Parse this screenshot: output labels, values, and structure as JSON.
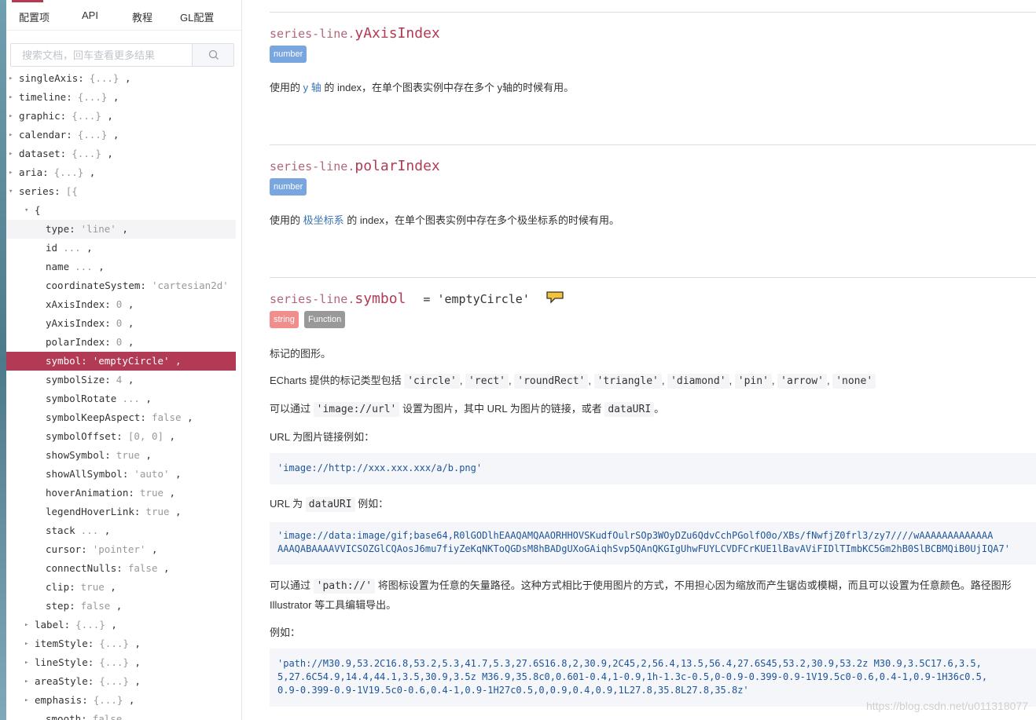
{
  "tabs": [
    "配置项",
    "API",
    "教程",
    "GL配置"
  ],
  "search": {
    "placeholder": "搜索文档，回车查看更多结果",
    "icon": "search-icon"
  },
  "tree": [
    {
      "arrow": "▸",
      "indent": 0,
      "key": "singleAxis:",
      "val": "{...}",
      "tail": " ,"
    },
    {
      "arrow": "▸",
      "indent": 0,
      "key": "timeline:",
      "val": "{...}",
      "tail": " ,"
    },
    {
      "arrow": "▸",
      "indent": 0,
      "key": "graphic:",
      "val": "{...}",
      "tail": " ,"
    },
    {
      "arrow": "▸",
      "indent": 0,
      "key": "calendar:",
      "val": "{...}",
      "tail": " ,"
    },
    {
      "arrow": "▸",
      "indent": 0,
      "key": "dataset:",
      "val": "{...}",
      "tail": " ,"
    },
    {
      "arrow": "▸",
      "indent": 0,
      "key": "aria:",
      "val": "{...}",
      "tail": " ,"
    },
    {
      "arrow": "▾",
      "indent": 0,
      "key": "series:",
      "val": "[{",
      "tail": ""
    },
    {
      "arrow": "▾",
      "indent": 1,
      "key": "{",
      "val": "",
      "tail": ""
    },
    {
      "arrow": "",
      "indent": 2,
      "key": "type:",
      "val": "'line'",
      "tail": " ,",
      "state": "light"
    },
    {
      "arrow": "",
      "indent": 2,
      "key": "id",
      "val": "...",
      "tail": " ,"
    },
    {
      "arrow": "",
      "indent": 2,
      "key": "name",
      "val": "...",
      "tail": " ,"
    },
    {
      "arrow": "",
      "indent": 2,
      "key": "coordinateSystem:",
      "val": "'cartesian2d'",
      "tail": ""
    },
    {
      "arrow": "",
      "indent": 2,
      "key": "xAxisIndex:",
      "val": "0",
      "tail": " ,"
    },
    {
      "arrow": "",
      "indent": 2,
      "key": "yAxisIndex:",
      "val": "0",
      "tail": " ,"
    },
    {
      "arrow": "",
      "indent": 2,
      "key": "polarIndex:",
      "val": "0",
      "tail": " ,"
    },
    {
      "arrow": "",
      "indent": 2,
      "key": "symbol:",
      "val": "'emptyCircle'",
      "tail": " ,",
      "state": "active"
    },
    {
      "arrow": "",
      "indent": 2,
      "key": "symbolSize:",
      "val": "4",
      "tail": " ,"
    },
    {
      "arrow": "",
      "indent": 2,
      "key": "symbolRotate",
      "val": "...",
      "tail": " ,"
    },
    {
      "arrow": "",
      "indent": 2,
      "key": "symbolKeepAspect:",
      "val": "false",
      "tail": " ,"
    },
    {
      "arrow": "",
      "indent": 2,
      "key": "symbolOffset:",
      "val": "[0, 0]",
      "tail": " ,"
    },
    {
      "arrow": "",
      "indent": 2,
      "key": "showSymbol:",
      "val": "true",
      "tail": " ,"
    },
    {
      "arrow": "",
      "indent": 2,
      "key": "showAllSymbol:",
      "val": "'auto'",
      "tail": " ,"
    },
    {
      "arrow": "",
      "indent": 2,
      "key": "hoverAnimation:",
      "val": "true",
      "tail": " ,"
    },
    {
      "arrow": "",
      "indent": 2,
      "key": "legendHoverLink:",
      "val": "true",
      "tail": " ,"
    },
    {
      "arrow": "",
      "indent": 2,
      "key": "stack",
      "val": "...",
      "tail": " ,"
    },
    {
      "arrow": "",
      "indent": 2,
      "key": "cursor:",
      "val": "'pointer'",
      "tail": " ,"
    },
    {
      "arrow": "",
      "indent": 2,
      "key": "connectNulls:",
      "val": "false",
      "tail": " ,"
    },
    {
      "arrow": "",
      "indent": 2,
      "key": "clip:",
      "val": "true",
      "tail": " ,"
    },
    {
      "arrow": "",
      "indent": 2,
      "key": "step:",
      "val": "false",
      "tail": " ,"
    },
    {
      "arrow": "▸",
      "indent": 1,
      "key": "label:",
      "val": "{...}",
      "tail": " ,"
    },
    {
      "arrow": "▸",
      "indent": 1,
      "key": "itemStyle:",
      "val": "{...}",
      "tail": " ,"
    },
    {
      "arrow": "▸",
      "indent": 1,
      "key": "lineStyle:",
      "val": "{...}",
      "tail": " ,"
    },
    {
      "arrow": "▸",
      "indent": 1,
      "key": "areaStyle:",
      "val": "{...}",
      "tail": " ,"
    },
    {
      "arrow": "▸",
      "indent": 1,
      "key": "emphasis:",
      "val": "{...}",
      "tail": " ,"
    },
    {
      "arrow": "",
      "indent": 2,
      "key": "smooth:",
      "val": "false",
      "tail": ""
    }
  ],
  "doc": {
    "yAxisIndex": {
      "prefix": "series-line.",
      "name": "yAxisIndex",
      "badge": "number",
      "desc_pre": "使用的 ",
      "desc_link": "y 轴",
      "desc_post": " 的 index，在单个图表实例中存在多个 y轴的时候有用。"
    },
    "polarIndex": {
      "prefix": "series-line.",
      "name": "polarIndex",
      "badge": "number",
      "desc_pre": "使用的 ",
      "desc_link": "极坐标系",
      "desc_post": " 的 index，在单个图表实例中存在多个极坐标系的时候有用。"
    },
    "symbol": {
      "prefix": "series-line.",
      "name": "symbol",
      "default": "= 'emptyCircle'",
      "badge_string": "string",
      "badge_function": "Function",
      "p1": "标记的图形。",
      "p2_pre": "ECharts 提供的标记类型包括 ",
      "types": [
        "'circle'",
        "'rect'",
        "'roundRect'",
        "'triangle'",
        "'diamond'",
        "'pin'",
        "'arrow'",
        "'none'"
      ],
      "p3_pre": "可以通过 ",
      "p3_code1": "'image://url'",
      "p3_mid": " 设置为图片，其中 URL 为图片的链接，或者 ",
      "p3_code2": "dataURI",
      "p3_post": "。",
      "p4": "URL 为图片链接例如：",
      "code1": "'image://http://xxx.xxx.xxx/a/b.png'",
      "p5_pre": "URL 为 ",
      "p5_code": "dataURI",
      "p5_post": " 例如：",
      "code2": [
        "'image://data:image/gif;base64,R0lGODlhEAAQAMQAAORHHOVSKudfOulrSOp3WOyDZu6QdvCchPGolfO0o/XBs/fNwfjZ0frl3/zy7////wAAAAAAAAAAAAA",
        "AAAQABAAAAVVICSOZGlCQAosJ6mu7fiyZeKqNKToQGDsM8hBADgUXoGAiqhSvp5QAnQKGIgUhwFUYLCVDFCrKUE1lBavAViFIDlTImbKC5Gm2hB0SlBCBMQiB0UjIQA7'"
      ],
      "p6a_pre": "可以通过 ",
      "p6a_code": "'path://'",
      "p6a_post": " 将图标设置为任意的矢量路径。这种方式相比于使用图片的方式，不用担心因为缩放而产生锯齿或模糊，而且可以设置为任意颜色。路径图形",
      "p6b": "Illustrator 等工具编辑导出。",
      "p7": "例如：",
      "code3": [
        "'path://M30.9,53.2C16.8,53.2,5.3,41.7,5.3,27.6S16.8,2,30.9,2C45,2,56.4,13.5,56.4,27.6S45,53.2,30.9,53.2z M30.9,3.5C17.6,3.5,",
        "5,27.6C54.9,14.4,44.1,3.5,30.9,3.5z M36.9,35.8c0,0.601-0.4,1-0.9,1h-1.3c-0.5,0-0.9-0.399-0.9-1V19.5c0-0.6,0.4-1,0.9-1H36c0.5,",
        "0.9-0.399-0.9-1V19.5c0-0.6,0.4-1,0.9-1H27c0.5,0,0.9,0.4,0.9,1L27.8,35.8L27.8,35.8z'"
      ]
    }
  },
  "watermark": "https://blog.csdn.net/u011318077",
  "colors": {
    "accent": "#b23a54",
    "link": "#3a73b2",
    "badge_number": "#7aa6e0",
    "badge_string": "#f08d8d",
    "badge_function": "#999999"
  }
}
